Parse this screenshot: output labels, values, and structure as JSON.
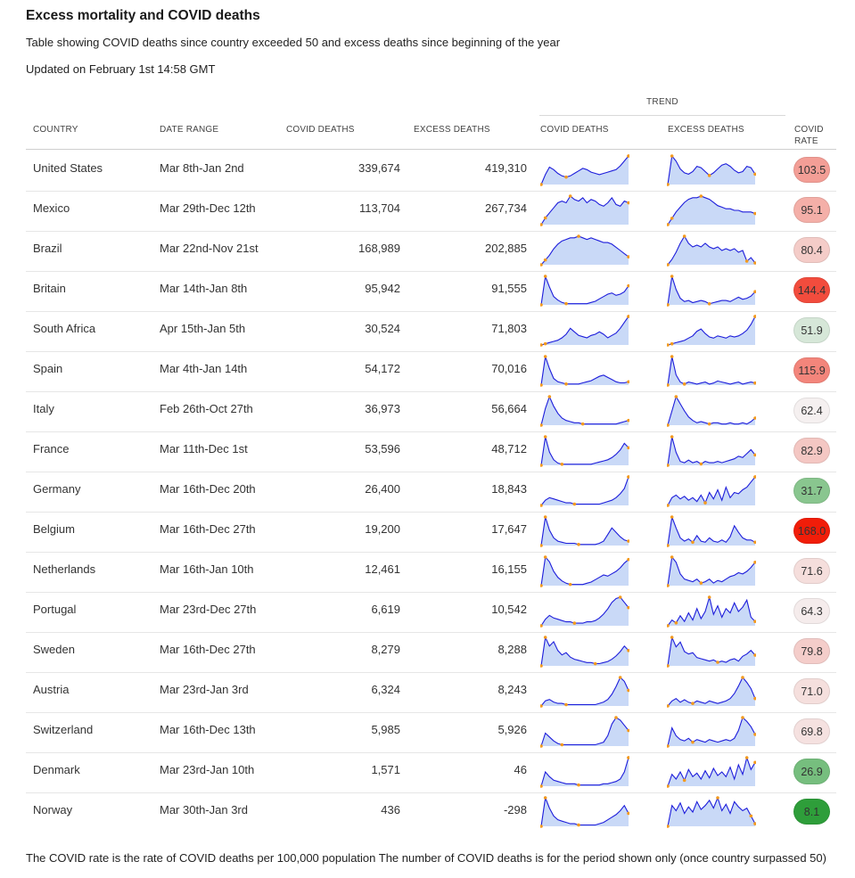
{
  "header": {
    "title": "Excess mortality and COVID deaths",
    "subtitle": "Table showing COVID deaths since country exceeded 50 and excess deaths since beginning of the year",
    "updated": "Updated on February 1st 14:58 GMT"
  },
  "columns": {
    "trend_group": "TREND",
    "country": "COUNTRY",
    "date_range": "DATE RANGE",
    "covid_deaths": "COVID DEATHS",
    "excess_deaths": "EXCESS DEATHS",
    "trend_covid": "COVID DEATHS",
    "trend_excess": "EXCESS DEATHS",
    "covid_rate_1": "COVID",
    "covid_rate_2": "RATE"
  },
  "footer": "The COVID rate is the rate of COVID deaths per 100,000 population The number of COVID deaths is for the period shown only (once country surpassed 50)",
  "colors": {
    "spark_line": "#1d1ddb",
    "spark_fill": "#c9d9f7",
    "spark_dot": "#f39a1e",
    "rate_low": "#2e9e3a",
    "rate_mid": "#f5f5f5",
    "rate_high": "#f11d09"
  },
  "chart_data": {
    "type": "table",
    "rows": [
      {
        "country": "United States",
        "date_range": "Mar 8th-Jan 2nd",
        "covid_deaths": "339,674",
        "excess_deaths": "419,310",
        "covid_rate": "103.5",
        "rate_value": 103.5,
        "covid_trend": [
          0,
          8,
          14,
          12,
          9,
          7,
          6,
          7,
          9,
          11,
          13,
          12,
          10,
          9,
          8,
          9,
          10,
          11,
          12,
          15,
          19,
          23
        ],
        "excess_trend": [
          0,
          22,
          18,
          12,
          9,
          8,
          10,
          14,
          13,
          10,
          7,
          9,
          12,
          15,
          16,
          14,
          11,
          9,
          10,
          14,
          13,
          8
        ]
      },
      {
        "country": "Mexico",
        "date_range": "Mar 29th-Dec 12th",
        "covid_deaths": "113,704",
        "excess_deaths": "267,734",
        "covid_rate": "95.1",
        "rate_value": 95.1,
        "covid_trend": [
          0,
          4,
          7,
          10,
          13,
          14,
          13,
          17,
          15,
          14,
          16,
          13,
          15,
          14,
          12,
          11,
          13,
          16,
          12,
          11,
          14,
          13
        ],
        "excess_trend": [
          0,
          4,
          8,
          11,
          14,
          16,
          17,
          17,
          18,
          17,
          16,
          14,
          12,
          11,
          10,
          10,
          9,
          9,
          8,
          8,
          8,
          7
        ]
      },
      {
        "country": "Brazil",
        "date_range": "Mar 22nd-Nov 21st",
        "covid_deaths": "168,989",
        "excess_deaths": "202,885",
        "covid_rate": "80.4",
        "rate_value": 80.4,
        "covid_trend": [
          0,
          3,
          6,
          10,
          13,
          15,
          16,
          17,
          17,
          18,
          17,
          16,
          17,
          16,
          15,
          14,
          14,
          13,
          11,
          9,
          7,
          5
        ],
        "excess_trend": [
          0,
          3,
          7,
          12,
          16,
          12,
          10,
          11,
          10,
          12,
          10,
          9,
          10,
          8,
          9,
          8,
          9,
          7,
          8,
          2,
          4,
          1
        ]
      },
      {
        "country": "Britain",
        "date_range": "Mar 14th-Jan 8th",
        "covid_deaths": "95,942",
        "excess_deaths": "91,555",
        "covid_rate": "144.4",
        "rate_value": 144.4,
        "covid_trend": [
          0,
          24,
          15,
          7,
          4,
          2,
          1,
          1,
          1,
          1,
          1,
          1,
          2,
          3,
          5,
          7,
          9,
          10,
          8,
          9,
          11,
          16
        ],
        "excess_trend": [
          0,
          26,
          14,
          6,
          3,
          4,
          2,
          3,
          4,
          3,
          1,
          2,
          3,
          4,
          4,
          3,
          5,
          7,
          5,
          6,
          8,
          12
        ]
      },
      {
        "country": "South Africa",
        "date_range": "Apr 15th-Jan 5th",
        "covid_deaths": "30,524",
        "excess_deaths": "71,803",
        "covid_rate": "51.9",
        "rate_value": 51.9,
        "covid_trend": [
          0,
          1,
          2,
          3,
          4,
          6,
          9,
          14,
          11,
          8,
          7,
          6,
          8,
          9,
          11,
          9,
          6,
          8,
          10,
          14,
          19,
          24
        ],
        "excess_trend": [
          0,
          1,
          2,
          3,
          4,
          6,
          8,
          12,
          14,
          10,
          7,
          6,
          8,
          7,
          6,
          8,
          7,
          8,
          10,
          13,
          18,
          25
        ]
      },
      {
        "country": "Spain",
        "date_range": "Mar 4th-Jan 14th",
        "covid_deaths": "54,172",
        "excess_deaths": "70,016",
        "covid_rate": "115.9",
        "rate_value": 115.9,
        "covid_trend": [
          0,
          26,
          15,
          6,
          3,
          2,
          1,
          1,
          1,
          1,
          2,
          3,
          4,
          6,
          8,
          9,
          7,
          5,
          3,
          2,
          2,
          3
        ],
        "excess_trend": [
          0,
          28,
          10,
          3,
          1,
          3,
          2,
          1,
          2,
          3,
          1,
          2,
          4,
          3,
          2,
          1,
          2,
          3,
          1,
          2,
          3,
          2
        ]
      },
      {
        "country": "Italy",
        "date_range": "Feb 26th-Oct 27th",
        "covid_deaths": "36,973",
        "excess_deaths": "56,664",
        "covid_rate": "62.4",
        "rate_value": 62.4,
        "covid_trend": [
          0,
          14,
          24,
          16,
          10,
          6,
          4,
          3,
          2,
          2,
          1,
          1,
          1,
          1,
          1,
          1,
          1,
          1,
          1,
          2,
          3,
          4
        ],
        "excess_trend": [
          0,
          12,
          24,
          18,
          12,
          7,
          4,
          2,
          3,
          2,
          1,
          2,
          2,
          1,
          1,
          2,
          1,
          1,
          2,
          1,
          3,
          6
        ]
      },
      {
        "country": "France",
        "date_range": "Mar 11th-Dec 1st",
        "covid_deaths": "53,596",
        "excess_deaths": "48,712",
        "covid_rate": "82.9",
        "rate_value": 82.9,
        "covid_trend": [
          0,
          26,
          12,
          5,
          2,
          1,
          1,
          1,
          1,
          1,
          1,
          1,
          1,
          2,
          3,
          4,
          5,
          7,
          10,
          14,
          20,
          16
        ],
        "excess_trend": [
          0,
          22,
          10,
          3,
          2,
          4,
          2,
          3,
          1,
          3,
          2,
          2,
          3,
          2,
          3,
          4,
          5,
          7,
          6,
          9,
          12,
          8
        ]
      },
      {
        "country": "Germany",
        "date_range": "Mar 16th-Dec 20th",
        "covid_deaths": "26,400",
        "excess_deaths": "18,843",
        "covid_rate": "31.7",
        "rate_value": 31.7,
        "covid_trend": [
          0,
          4,
          6,
          5,
          4,
          3,
          2,
          2,
          1,
          1,
          1,
          1,
          1,
          1,
          1,
          2,
          3,
          4,
          6,
          9,
          13,
          22
        ],
        "excess_trend": [
          0,
          6,
          8,
          5,
          7,
          4,
          6,
          3,
          8,
          2,
          10,
          5,
          12,
          4,
          14,
          6,
          10,
          9,
          12,
          14,
          18,
          22
        ]
      },
      {
        "country": "Belgium",
        "date_range": "Mar 16th-Dec 27th",
        "covid_deaths": "19,200",
        "excess_deaths": "17,647",
        "covid_rate": "168.0",
        "rate_value": 168.0,
        "covid_trend": [
          0,
          26,
          14,
          7,
          4,
          3,
          2,
          2,
          2,
          1,
          1,
          1,
          1,
          1,
          2,
          4,
          10,
          16,
          12,
          8,
          5,
          4
        ],
        "excess_trend": [
          0,
          26,
          16,
          7,
          4,
          6,
          3,
          9,
          4,
          3,
          7,
          4,
          3,
          5,
          3,
          8,
          18,
          12,
          7,
          5,
          5,
          3
        ]
      },
      {
        "country": "Netherlands",
        "date_range": "Mar 16th-Jan 10th",
        "covid_deaths": "12,461",
        "excess_deaths": "16,155",
        "covid_rate": "71.6",
        "rate_value": 71.6,
        "covid_trend": [
          0,
          24,
          20,
          12,
          7,
          4,
          2,
          1,
          1,
          1,
          1,
          2,
          3,
          5,
          7,
          9,
          8,
          10,
          12,
          15,
          19,
          22
        ],
        "excess_trend": [
          0,
          22,
          18,
          9,
          5,
          4,
          3,
          5,
          2,
          3,
          5,
          2,
          4,
          3,
          5,
          7,
          8,
          10,
          9,
          11,
          14,
          18
        ]
      },
      {
        "country": "Portugal",
        "date_range": "Mar 23rd-Dec 27th",
        "covid_deaths": "6,619",
        "excess_deaths": "10,542",
        "covid_rate": "64.3",
        "rate_value": 64.3,
        "covid_trend": [
          0,
          5,
          8,
          6,
          5,
          4,
          3,
          3,
          2,
          2,
          2,
          3,
          3,
          4,
          6,
          9,
          13,
          18,
          21,
          22,
          18,
          14
        ],
        "excess_trend": [
          0,
          4,
          2,
          7,
          3,
          9,
          4,
          12,
          5,
          10,
          20,
          8,
          14,
          6,
          12,
          9,
          16,
          10,
          13,
          18,
          6,
          3
        ]
      },
      {
        "country": "Sweden",
        "date_range": "Mar 16th-Dec 27th",
        "covid_deaths": "8,279",
        "excess_deaths": "8,288",
        "covid_rate": "79.8",
        "rate_value": 79.8,
        "covid_trend": [
          0,
          26,
          18,
          22,
          14,
          10,
          12,
          8,
          6,
          5,
          4,
          3,
          3,
          2,
          2,
          3,
          4,
          6,
          9,
          13,
          18,
          14
        ],
        "excess_trend": [
          0,
          24,
          16,
          20,
          12,
          10,
          11,
          7,
          6,
          5,
          4,
          5,
          3,
          4,
          3,
          5,
          6,
          4,
          8,
          10,
          13,
          9
        ]
      },
      {
        "country": "Austria",
        "date_range": "Mar 23rd-Jan 3rd",
        "covid_deaths": "6,324",
        "excess_deaths": "8,243",
        "covid_rate": "71.0",
        "rate_value": 71.0,
        "covid_trend": [
          0,
          4,
          5,
          3,
          2,
          2,
          1,
          1,
          1,
          1,
          1,
          1,
          1,
          1,
          2,
          3,
          5,
          9,
          15,
          22,
          19,
          12
        ],
        "excess_trend": [
          0,
          4,
          6,
          3,
          5,
          3,
          2,
          4,
          3,
          2,
          4,
          3,
          2,
          3,
          4,
          6,
          10,
          16,
          23,
          19,
          14,
          6
        ]
      },
      {
        "country": "Switzerland",
        "date_range": "Mar 16th-Dec 13th",
        "covid_deaths": "5,985",
        "excess_deaths": "5,926",
        "covid_rate": "69.8",
        "rate_value": 69.8,
        "covid_trend": [
          0,
          10,
          7,
          4,
          2,
          1,
          1,
          1,
          1,
          1,
          1,
          1,
          1,
          1,
          2,
          3,
          8,
          17,
          22,
          20,
          16,
          12
        ],
        "excess_trend": [
          0,
          14,
          8,
          5,
          4,
          6,
          3,
          5,
          4,
          3,
          5,
          4,
          3,
          4,
          5,
          4,
          6,
          12,
          22,
          19,
          15,
          9
        ]
      },
      {
        "country": "Denmark",
        "date_range": "Mar 23rd-Jan 10th",
        "covid_deaths": "1,571",
        "excess_deaths": "46",
        "covid_rate": "26.9",
        "rate_value": 26.9,
        "covid_trend": [
          0,
          12,
          8,
          5,
          4,
          3,
          2,
          2,
          2,
          1,
          1,
          1,
          1,
          1,
          1,
          2,
          2,
          3,
          4,
          6,
          12,
          24
        ],
        "excess_trend": [
          0,
          10,
          6,
          12,
          5,
          14,
          8,
          11,
          6,
          13,
          7,
          15,
          9,
          12,
          8,
          16,
          6,
          18,
          10,
          24,
          14,
          20
        ]
      },
      {
        "country": "Norway",
        "date_range": "Mar 30th-Jan 3rd",
        "covid_deaths": "436",
        "excess_deaths": "-298",
        "covid_rate": "8.1",
        "rate_value": 8.1,
        "covid_trend": [
          0,
          22,
          14,
          8,
          5,
          4,
          3,
          2,
          2,
          1,
          1,
          1,
          1,
          1,
          2,
          3,
          5,
          7,
          9,
          12,
          16,
          10
        ],
        "excess_trend": [
          0,
          16,
          12,
          18,
          10,
          15,
          11,
          19,
          13,
          16,
          20,
          14,
          22,
          12,
          17,
          10,
          19,
          15,
          12,
          14,
          8,
          2
        ]
      }
    ]
  }
}
